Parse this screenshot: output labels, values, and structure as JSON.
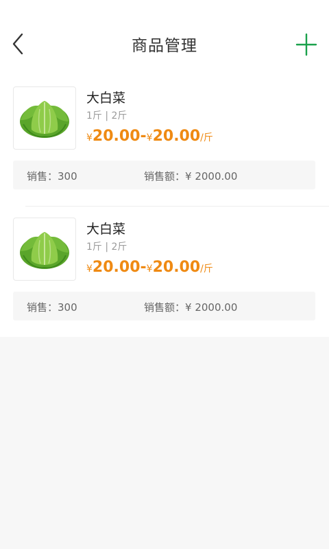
{
  "header": {
    "title": "商品管理",
    "back_icon": "chevron-left-icon",
    "add_icon": "plus-icon",
    "accent_color": "#1aa14b"
  },
  "products": [
    {
      "name": "大白菜",
      "specs": "1斤 | 2斤",
      "price_currency": "¥",
      "price_low": "20.00",
      "price_high": "20.00",
      "price_sep": "-",
      "unit": "/斤",
      "sales_label": "销售：",
      "sales_value": "300",
      "revenue_label": "销售额：",
      "revenue_value": "¥ 2000.00"
    },
    {
      "name": "大白菜",
      "specs": "1斤 | 2斤",
      "price_currency": "¥",
      "price_low": "20.00",
      "price_high": "20.00",
      "price_sep": "-",
      "unit": "/斤",
      "sales_label": "销售：",
      "sales_value": "300",
      "revenue_label": "销售额：",
      "revenue_value": "¥ 2000.00"
    }
  ],
  "colors": {
    "price": "#ef8a13",
    "background": "#f7f7f7"
  }
}
